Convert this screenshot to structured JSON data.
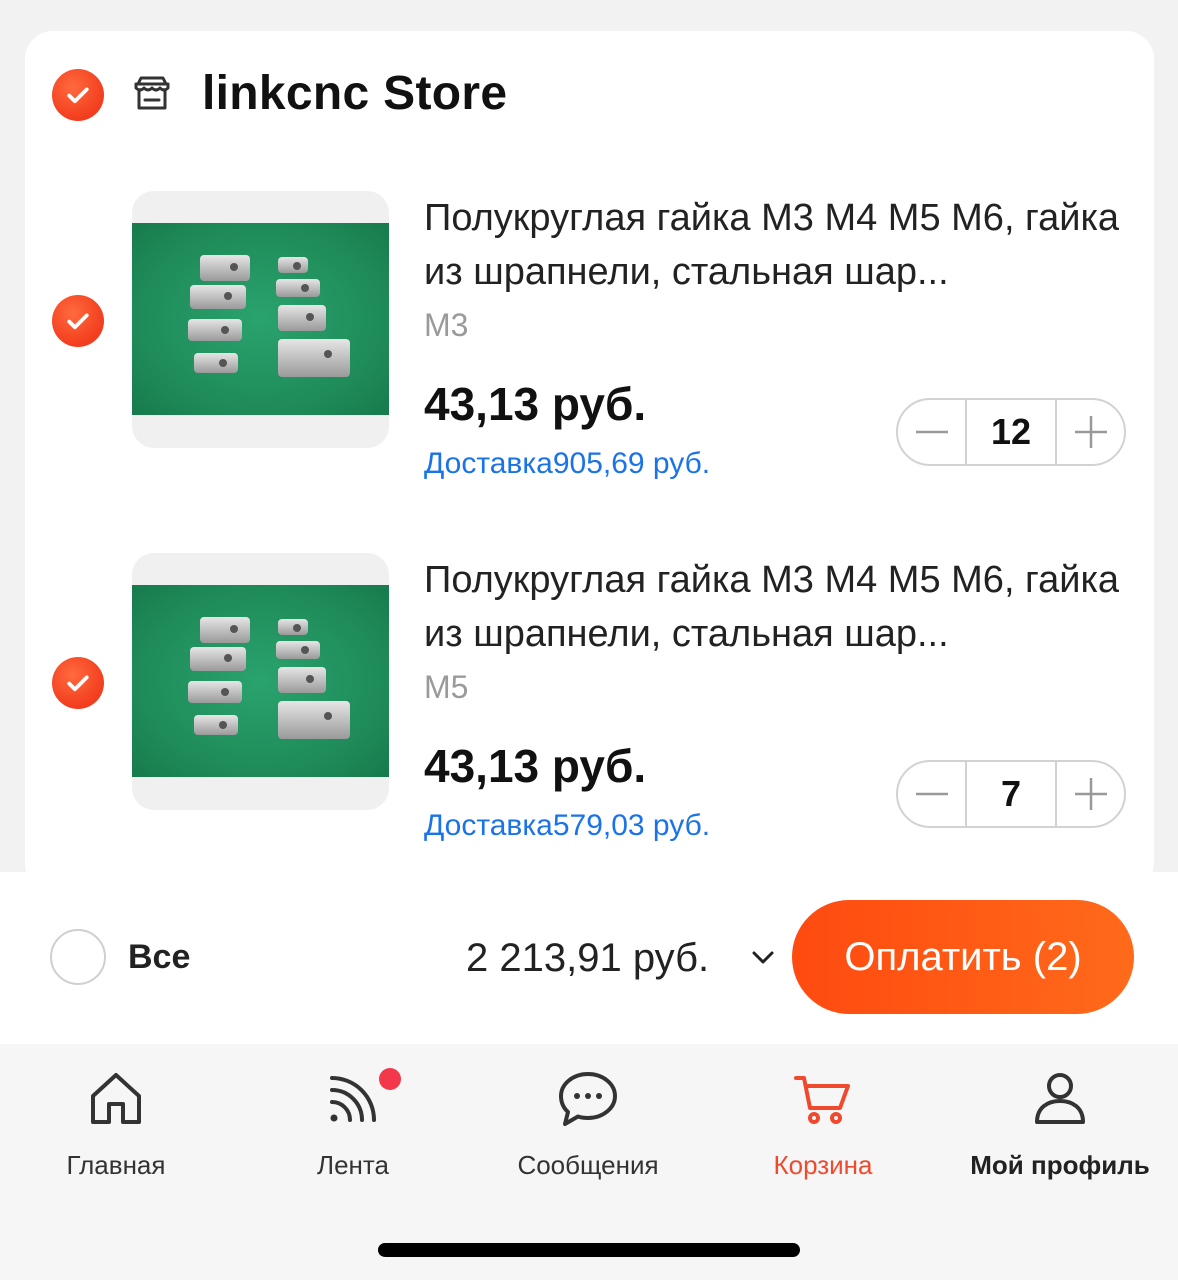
{
  "store": {
    "name": "linkcnc Store"
  },
  "items": [
    {
      "title": "Полукруглая гайка М3 М4 М5 М6, гайка из шрапнели, стальная шар...",
      "variant": "M3",
      "price": "43,13 руб.",
      "delivery": "Доставка905,69 руб.",
      "quantity": "12",
      "selected": true
    },
    {
      "title": "Полукруглая гайка М3 М4 М5 М6, гайка из шрапнели, стальная шар...",
      "variant": "M5",
      "price": "43,13 руб.",
      "delivery": "Доставка579,03 руб.",
      "quantity": "7",
      "selected": true
    }
  ],
  "checkout": {
    "select_all_label": "Все",
    "total": "2 213,91 руб.",
    "pay_label": "Оплатить (2)"
  },
  "tabbar": {
    "tabs": [
      {
        "label": "Главная",
        "icon": "home-icon"
      },
      {
        "label": "Лента",
        "icon": "feed-icon",
        "badge": true
      },
      {
        "label": "Сообщения",
        "icon": "messages-icon"
      },
      {
        "label": "Корзина",
        "icon": "cart-icon",
        "active": true
      },
      {
        "label": "Мой профиль",
        "icon": "profile-icon"
      }
    ]
  },
  "colors": {
    "accent": "#f23d1e",
    "link": "#1a73e8",
    "active_tab": "#f04a2e",
    "badge": "#f2384a"
  }
}
